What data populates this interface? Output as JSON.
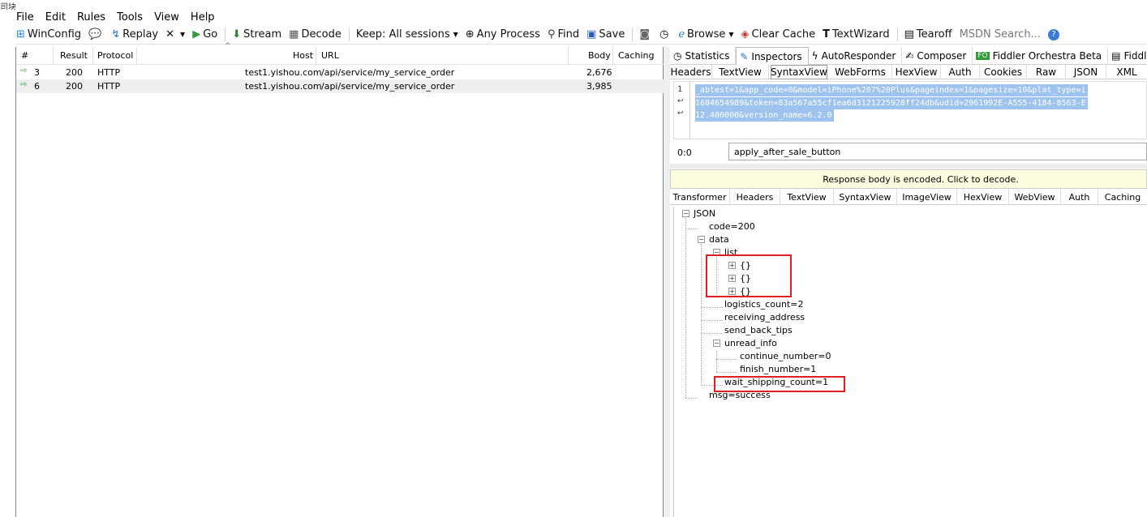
{
  "edge_text": "司块",
  "menu": [
    "File",
    "Edit",
    "Rules",
    "Tools",
    "View",
    "Help"
  ],
  "toolbar": {
    "winconfig": "WinConfig",
    "replay": "Replay",
    "go": "Go",
    "stream": "Stream",
    "decode": "Decode",
    "keep": "Keep: All sessions",
    "any_process": "Any Process",
    "find": "Find",
    "save": "Save",
    "browse": "Browse",
    "clear_cache": "Clear Cache",
    "textwizard": "TextWizard",
    "tearoff": "Tearoff",
    "search_placeholder": "MSDN Search..."
  },
  "sessions": {
    "columns": [
      "#",
      "Result",
      "Protocol",
      "Host",
      "URL",
      "Body",
      "Caching"
    ],
    "rows": [
      {
        "id": "3",
        "result": "200",
        "protocol": "HTTP",
        "host": "test1.yishou.com",
        "url": "/api/service/my_service_order",
        "body": "2,676",
        "caching": ""
      },
      {
        "id": "6",
        "result": "200",
        "protocol": "HTTP",
        "host": "test1.yishou.com",
        "url": "/api/service/my_service_order",
        "body": "3,985",
        "caching": ""
      }
    ]
  },
  "inspector_tabs": [
    "Statistics",
    "Inspectors",
    "AutoResponder",
    "Composer",
    "Fiddler Orchestra Beta",
    "FiddlerScript"
  ],
  "request_tabs": [
    "Headers",
    "TextView",
    "SyntaxView",
    "WebForms",
    "HexView",
    "Auth",
    "Cookies",
    "Raw",
    "JSON",
    "XML"
  ],
  "request_body": {
    "line_numbers": [
      "1"
    ],
    "lines": [
      "_abtest=1&app_code=0&model=iPhone%207%20Plus&pageindex=1&pagesize=10&plat_type=i",
      "1604654989&token=83a567a55cf1ea6d3121225928ff24db&udid=2961992E-A555-4184-8563-E",
      "12.400000&version_name=6.2.0"
    ],
    "position": "0:0",
    "find_value": "apply_after_sale_button"
  },
  "response": {
    "banner": "Response body is encoded. Click to decode.",
    "tabs": [
      "Transformer",
      "Headers",
      "TextView",
      "SyntaxView",
      "ImageView",
      "HexView",
      "WebView",
      "Auth",
      "Caching"
    ],
    "tree": {
      "root": "JSON",
      "code": "code=200",
      "data": "data",
      "list": "list",
      "list_items": [
        "{}",
        "{}",
        "{}"
      ],
      "logistics_count": "logistics_count=2",
      "receiving_address": "receiving_address",
      "send_back_tips": "send_back_tips",
      "unread_info": "unread_info",
      "continue_number": "continue_number=0",
      "finish_number": "finish_number=1",
      "wait_shipping_count": "wait_shipping_count=1",
      "msg": "msg=success"
    }
  },
  "colors": {
    "highlight_box": "#e02020",
    "selection": "#9fc3ef",
    "banner": "#fffde0"
  }
}
